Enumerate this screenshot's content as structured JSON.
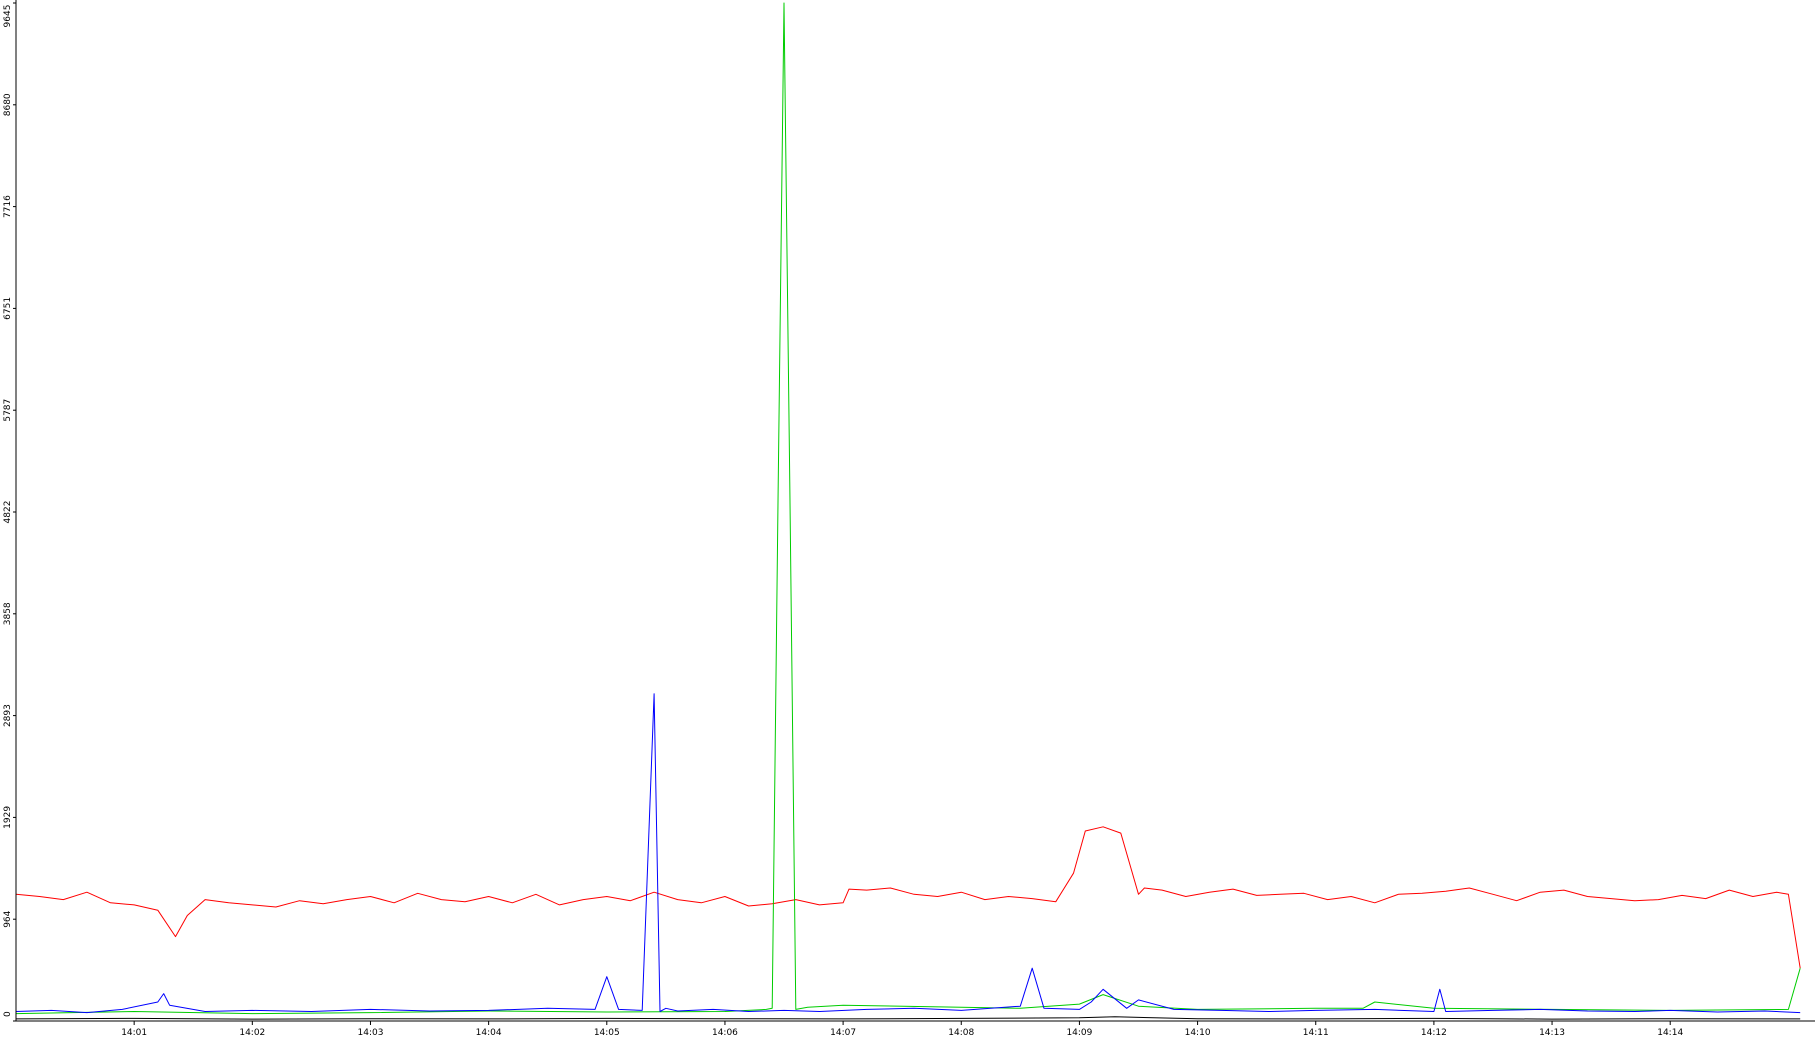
{
  "chart_data": {
    "type": "line",
    "title": "",
    "xlabel": "",
    "ylabel": "",
    "ylim": [
      0,
      9645
    ],
    "xlim_minutes": [
      13.0,
      28.2
    ],
    "grid": false,
    "legend": "none",
    "y_ticks": [
      "0",
      "964",
      "1929",
      "2893",
      "3858",
      "4822",
      "5787",
      "6751",
      "7716",
      "8680",
      "9645"
    ],
    "x_ticks": [
      {
        "label": "14:01",
        "minute": 14
      },
      {
        "label": "14:02",
        "minute": 15
      },
      {
        "label": "14:03",
        "minute": 16
      },
      {
        "label": "14:04",
        "minute": 17
      },
      {
        "label": "14:05",
        "minute": 18
      },
      {
        "label": "14:06",
        "minute": 19
      },
      {
        "label": "14:07",
        "minute": 20
      },
      {
        "label": "14:08",
        "minute": 21
      },
      {
        "label": "14:09",
        "minute": 22
      },
      {
        "label": "14:10",
        "minute": 23
      },
      {
        "label": "14:11",
        "minute": 24
      },
      {
        "label": "14:12",
        "minute": 25
      },
      {
        "label": "14:13",
        "minute": 26
      },
      {
        "label": "14:14",
        "minute": 27
      }
    ],
    "series": [
      {
        "color": "#ff0000",
        "x": [
          13.0,
          13.2,
          13.4,
          13.6,
          13.8,
          14.0,
          14.2,
          14.35,
          14.45,
          14.6,
          14.8,
          15.0,
          15.2,
          15.4,
          15.6,
          15.8,
          16.0,
          16.2,
          16.4,
          16.6,
          16.8,
          17.0,
          17.2,
          17.4,
          17.6,
          17.8,
          18.0,
          18.2,
          18.4,
          18.6,
          18.8,
          19.0,
          19.2,
          19.4,
          19.6,
          19.8,
          20.0,
          20.05,
          20.2,
          20.4,
          20.6,
          20.8,
          21.0,
          21.2,
          21.4,
          21.6,
          21.8,
          21.95,
          22.05,
          22.2,
          22.35,
          22.5,
          22.55,
          22.7,
          22.9,
          23.1,
          23.3,
          23.5,
          23.7,
          23.9,
          24.1,
          24.3,
          24.5,
          24.7,
          24.9,
          25.1,
          25.3,
          25.5,
          25.7,
          25.9,
          26.1,
          26.3,
          26.5,
          26.7,
          26.9,
          27.1,
          27.3,
          27.5,
          27.7,
          27.9,
          28.0,
          28.1
        ],
        "y": [
          1200,
          1180,
          1150,
          1220,
          1120,
          1100,
          1050,
          800,
          1000,
          1150,
          1120,
          1100,
          1080,
          1140,
          1110,
          1150,
          1180,
          1120,
          1210,
          1150,
          1130,
          1180,
          1120,
          1200,
          1100,
          1150,
          1180,
          1140,
          1220,
          1150,
          1120,
          1180,
          1090,
          1110,
          1150,
          1100,
          1120,
          1250,
          1240,
          1260,
          1200,
          1180,
          1220,
          1150,
          1180,
          1160,
          1130,
          1400,
          1800,
          1840,
          1780,
          1200,
          1260,
          1240,
          1180,
          1220,
          1250,
          1190,
          1200,
          1210,
          1150,
          1180,
          1120,
          1200,
          1210,
          1230,
          1260,
          1200,
          1140,
          1220,
          1240,
          1180,
          1160,
          1140,
          1150,
          1190,
          1160,
          1240,
          1180,
          1220,
          1200,
          500
        ]
      },
      {
        "color": "#00cc00",
        "x": [
          13.0,
          14.0,
          15.0,
          16.0,
          17.0,
          18.0,
          19.0,
          19.35,
          19.4,
          19.45,
          19.5,
          19.55,
          19.6,
          19.7,
          20.0,
          21.0,
          21.5,
          22.0,
          22.2,
          22.5,
          23.0,
          24.0,
          24.4,
          24.5,
          25.0,
          26.0,
          27.0,
          28.0,
          28.1
        ],
        "y": [
          70,
          90,
          70,
          80,
          95,
          85,
          90,
          110,
          120,
          5000,
          9645,
          5000,
          110,
          130,
          150,
          130,
          120,
          160,
          250,
          140,
          110,
          120,
          120,
          180,
          120,
          110,
          100,
          110,
          500
        ]
      },
      {
        "color": "#0000ff",
        "x": [
          13.0,
          13.3,
          13.6,
          13.9,
          14.2,
          14.25,
          14.3,
          14.6,
          15.0,
          15.5,
          16.0,
          16.5,
          17.0,
          17.5,
          17.9,
          18.0,
          18.1,
          18.3,
          18.4,
          18.45,
          18.5,
          18.6,
          18.9,
          19.2,
          19.5,
          19.8,
          20.2,
          20.6,
          21.0,
          21.5,
          21.6,
          21.7,
          22.0,
          22.1,
          22.2,
          22.4,
          22.5,
          22.8,
          23.2,
          23.6,
          24.0,
          24.5,
          25.0,
          25.05,
          25.1,
          25.5,
          25.9,
          26.3,
          26.7,
          27.0,
          27.4,
          27.8,
          28.1
        ],
        "y": [
          90,
          100,
          80,
          110,
          180,
          260,
          150,
          90,
          100,
          90,
          110,
          95,
          100,
          120,
          110,
          420,
          110,
          100,
          3100,
          90,
          120,
          95,
          110,
          90,
          100,
          90,
          110,
          120,
          100,
          140,
          500,
          120,
          110,
          180,
          300,
          120,
          200,
          110,
          100,
          90,
          100,
          110,
          90,
          300,
          90,
          100,
          110,
          95,
          90,
          100,
          85,
          95,
          80
        ]
      },
      {
        "color": "#000000",
        "x": [
          13.0,
          14.0,
          15.0,
          16.0,
          17.0,
          18.0,
          19.0,
          20.0,
          21.0,
          22.0,
          22.3,
          23.0,
          24.0,
          25.0,
          26.0,
          27.0,
          28.1
        ],
        "y": [
          20,
          25,
          18,
          22,
          20,
          25,
          22,
          20,
          25,
          30,
          40,
          22,
          20,
          25,
          18,
          22,
          20
        ]
      }
    ]
  }
}
